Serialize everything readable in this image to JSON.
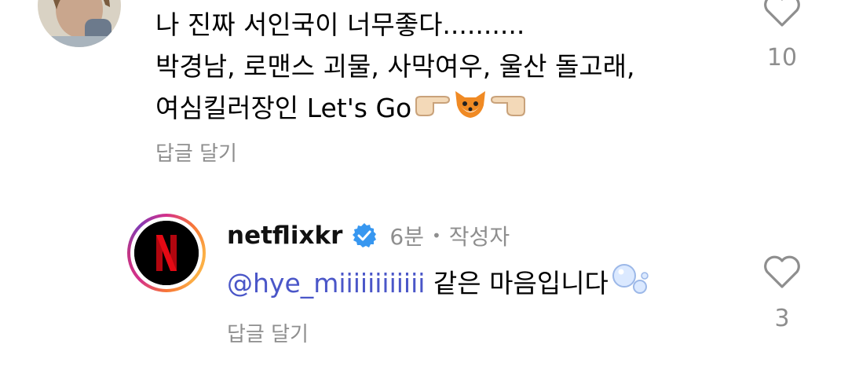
{
  "comments": [
    {
      "lines": [
        "나 진짜 서인국이 너무좋다..........",
        "박경남, 로맨스 괴물, 사막여우, 울산 돌고래,",
        "여심킬러장인 Let's Go"
      ],
      "emojis": [
        "point-right-emoji",
        "fox-emoji",
        "point-left-emoji"
      ],
      "reply_label": "답글 달기",
      "like_count": "10"
    }
  ],
  "reply": {
    "username": "netflixkr",
    "verified": true,
    "time": "6분",
    "separator": "•",
    "author_badge": "작성자",
    "mention": "@hye_miiiiiiiiiiii",
    "text": " 같은 마음입니다",
    "reply_label": "답글 달기",
    "like_count": "3"
  },
  "colors": {
    "accent_mention": "#4a56c8",
    "muted": "#8e8e8e",
    "verified_blue": "#3797f0",
    "netflix_red": "#c11119"
  }
}
